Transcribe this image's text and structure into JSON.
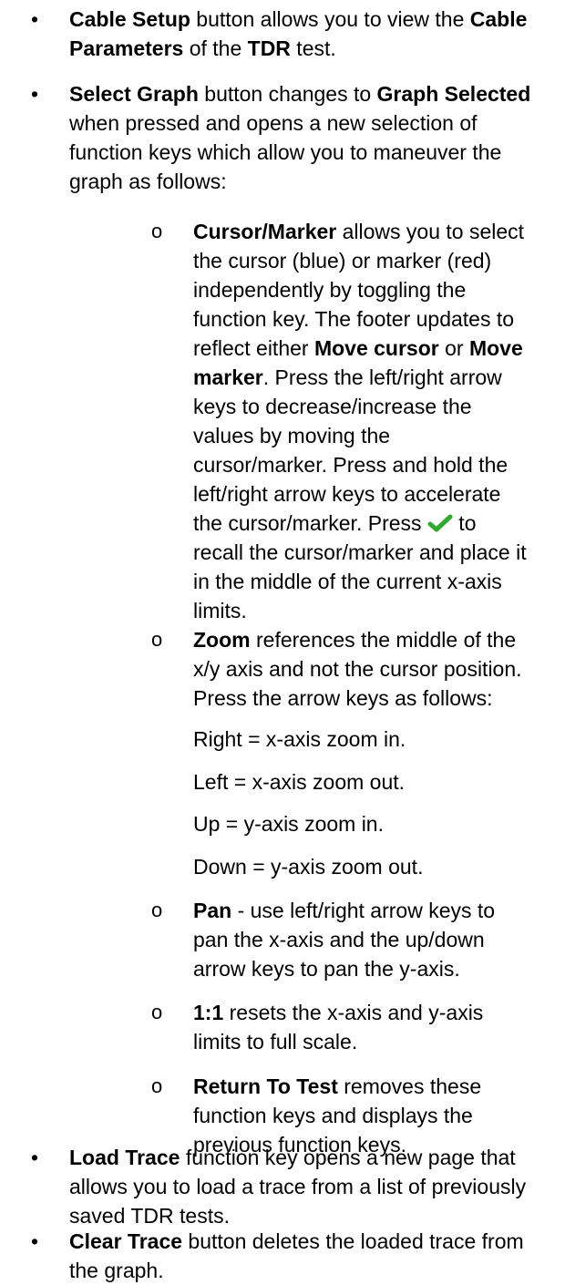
{
  "colors": {
    "check_mark": "#2eaa2e"
  },
  "items": {
    "cable_setup": {
      "b1": "Cable Setup",
      "t1": " button allows you to view the ",
      "b2": "Cable Parameters",
      "t2": " of the ",
      "b3": "TDR",
      "t3": " test."
    },
    "select_graph": {
      "b1": "Select Graph",
      "t1": " button changes to ",
      "b2": "Graph Selected",
      "t2": " when pressed and opens a new selection of function keys which allow you to maneuver the graph as follows:",
      "sub": {
        "cursor": {
          "b1": "Cursor/Marker",
          "t1": " allows you to select the cursor (blue) or marker (red) independently by toggling the function key. The footer updates to reflect either ",
          "b2": "Move cursor",
          "t2": " or ",
          "b3": "Move marker",
          "t3": ". Press the left/right arrow keys to decrease/increase the values by moving the cursor/marker. Press and hold the left/right arrow keys to accelerate the cursor/marker. Press ",
          "icon": "check-mark-icon",
          "t4": " to recall the cursor/marker and place it in the middle of the current x-axis limits."
        },
        "zoom": {
          "b1": "Zoom",
          "t1": " references the middle of the x/y axis and not the cursor position. Press the arrow keys as follows:",
          "lines": [
            "Right = x-axis zoom in.",
            "Left = x-axis zoom out.",
            "Up = y-axis zoom in.",
            "Down = y-axis zoom out."
          ]
        },
        "pan": {
          "b1": "Pan",
          "t1": " - use left/right arrow keys to pan the x-axis and the up/down arrow keys to pan the y-axis."
        },
        "one_to_one": {
          "b1": "1:1",
          "t1": " resets the x-axis and y-axis limits to full scale."
        },
        "return_to_test": {
          "b1": "Return To Test",
          "t1": " removes these function keys and displays the previous function keys."
        }
      }
    },
    "load_trace": {
      "b1": "Load Trace",
      "t1": " function key opens a new page that allows you to load a trace from a list of previously saved TDR tests."
    },
    "clear_trace": {
      "b1": "Clear Trace",
      "t1": " button deletes the loaded trace from the graph."
    }
  }
}
